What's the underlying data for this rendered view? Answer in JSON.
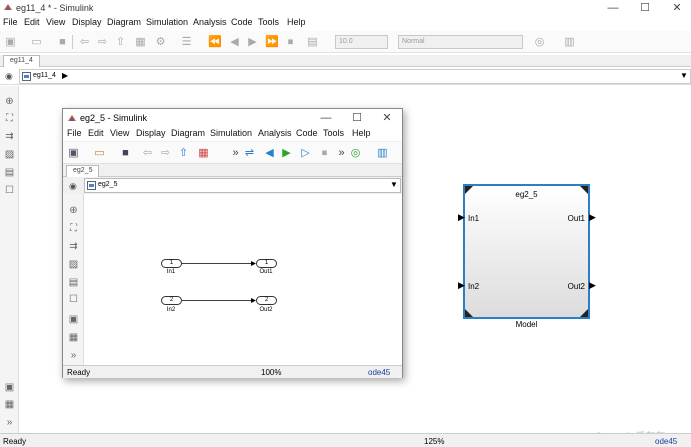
{
  "main": {
    "title": "eg11_4 * - Simulink",
    "menu": [
      "File",
      "Edit",
      "View",
      "Display",
      "Diagram",
      "Simulation",
      "Analysis",
      "Code",
      "Tools",
      "Help"
    ],
    "stop_time": "10.0",
    "sim_mode": "Normal",
    "tab": "eg11_4",
    "breadcrumb": "eg11_4",
    "status_left": "Ready",
    "status_zoom": "125%",
    "status_solver": "ode45"
  },
  "inner": {
    "title": "eg2_5 - Simulink",
    "menu": [
      "File",
      "Edit",
      "View",
      "Display",
      "Diagram",
      "Simulation",
      "Analysis",
      "Code",
      "Tools",
      "Help"
    ],
    "tab": "eg2_5",
    "breadcrumb": "eg2_5",
    "blocks": [
      {
        "inport": "1",
        "inport_label": "In1",
        "outport": "1",
        "outport_label": "Out1"
      },
      {
        "inport": "2",
        "inport_label": "In2",
        "outport": "2",
        "outport_label": "Out2"
      }
    ],
    "status_left": "Ready",
    "status_zoom": "100%",
    "status_solver": "ode45"
  },
  "model_block": {
    "name": "eg2_5",
    "in1": "In1",
    "in2": "In2",
    "out1": "Out1",
    "out2": "Out2",
    "caption": "Model"
  },
  "watermark": "CSDN @Zevalin爱灰灰",
  "colors": {
    "accent": "#2a7fc9",
    "solver": "#1c3c9c",
    "run_green": "#2aa52a"
  }
}
